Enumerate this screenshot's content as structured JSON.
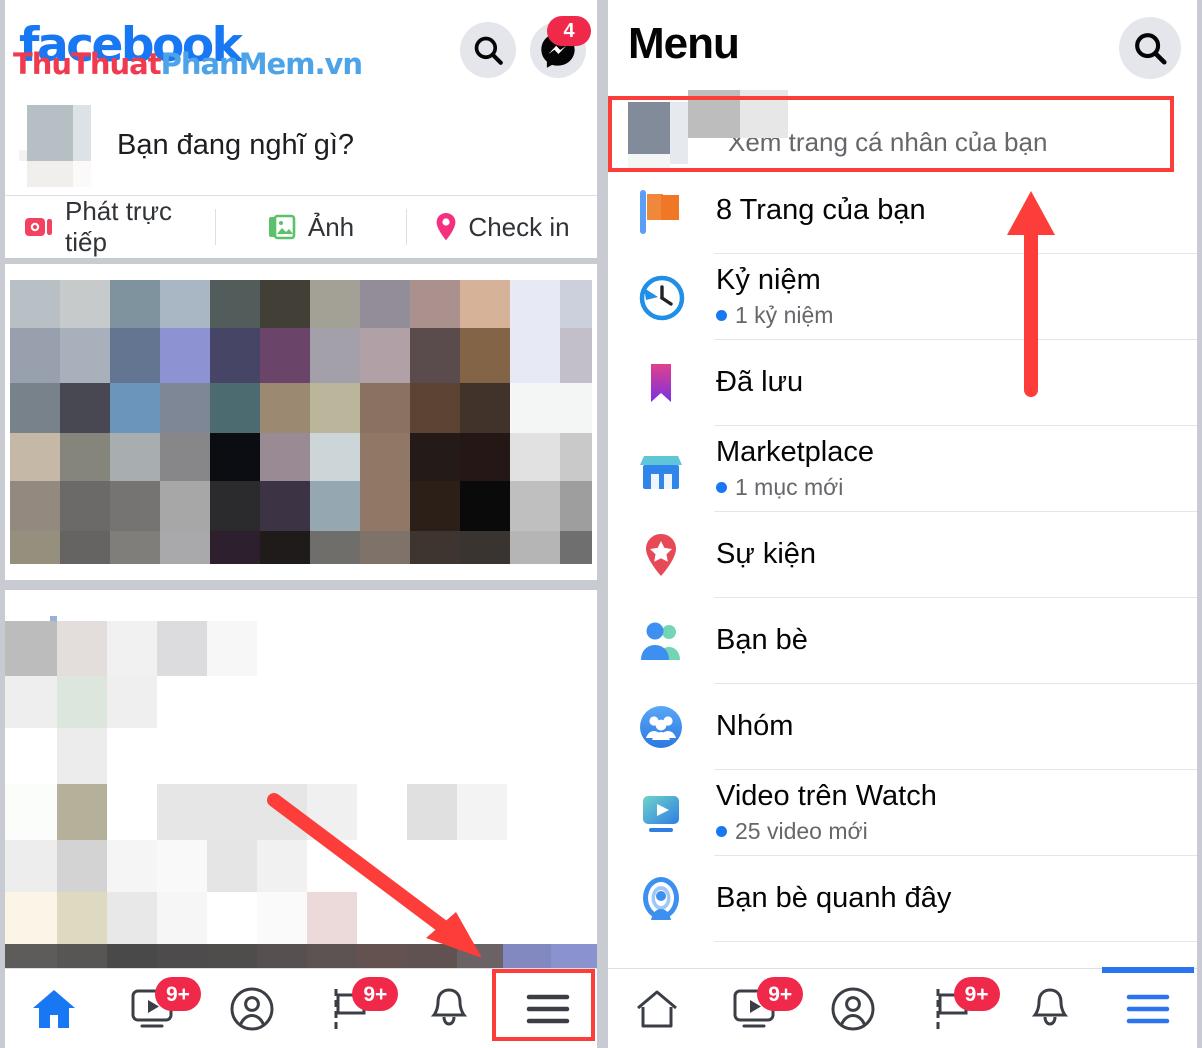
{
  "left_panel": {
    "brand": "facebook",
    "watermark": {
      "part1": "ThuThuat",
      "part2": "PhanMem.vn"
    },
    "header": {
      "search_icon": "search-icon",
      "messenger_icon": "messenger-icon",
      "messenger_badge": "4"
    },
    "composer": {
      "placeholder": "Bạn đang nghĩ gì?",
      "actions": [
        {
          "label": "Phát trực tiếp",
          "icon": "live-video-icon",
          "color": "#f3425f"
        },
        {
          "label": "Ảnh",
          "icon": "photo-icon",
          "color": "#45bd62"
        },
        {
          "label": "Check in",
          "icon": "location-pin-icon",
          "color": "#f5317f"
        }
      ]
    },
    "bottom_nav": [
      {
        "name": "home",
        "icon": "home-icon",
        "active": true,
        "badge": ""
      },
      {
        "name": "watch",
        "icon": "watch-video-icon",
        "active": false,
        "badge": "9+"
      },
      {
        "name": "profile",
        "icon": "profile-circle-icon",
        "active": false,
        "badge": ""
      },
      {
        "name": "pages",
        "icon": "pages-flag-icon",
        "active": false,
        "badge": "9+"
      },
      {
        "name": "notifications",
        "icon": "bell-icon",
        "active": false,
        "badge": ""
      },
      {
        "name": "menu",
        "icon": "hamburger-menu-icon",
        "active": false,
        "badge": ""
      }
    ]
  },
  "right_panel": {
    "title": "Menu",
    "search_icon": "search-icon",
    "profile": {
      "label": "Xem trang cá nhân của bạn"
    },
    "items": [
      {
        "label": "8 Trang của bạn",
        "sub": "",
        "icon": "pages-flag-icon"
      },
      {
        "label": "Kỷ niệm",
        "sub": "1 kỷ niệm",
        "icon": "memories-clock-icon"
      },
      {
        "label": "Đã lưu",
        "sub": "",
        "icon": "saved-bookmark-icon"
      },
      {
        "label": "Marketplace",
        "sub": "1 mục mới",
        "icon": "marketplace-storefront-icon"
      },
      {
        "label": "Sự kiện",
        "sub": "",
        "icon": "events-pin-icon"
      },
      {
        "label": "Bạn bè",
        "sub": "",
        "icon": "friends-icon"
      },
      {
        "label": "Nhóm",
        "sub": "",
        "icon": "groups-icon"
      },
      {
        "label": "Video trên Watch",
        "sub": "25 video mới",
        "icon": "watch-video-icon"
      },
      {
        "label": "Bạn bè quanh đây",
        "sub": "",
        "icon": "nearby-friends-icon"
      }
    ],
    "bottom_nav": [
      {
        "name": "home",
        "icon": "home-icon",
        "active": false,
        "badge": ""
      },
      {
        "name": "watch",
        "icon": "watch-video-icon",
        "active": false,
        "badge": "9+"
      },
      {
        "name": "profile",
        "icon": "profile-circle-icon",
        "active": false,
        "badge": ""
      },
      {
        "name": "pages",
        "icon": "pages-flag-icon",
        "active": false,
        "badge": "9+"
      },
      {
        "name": "notifications",
        "icon": "bell-icon",
        "active": false,
        "badge": ""
      },
      {
        "name": "menu",
        "icon": "hamburger-menu-icon",
        "active": true,
        "badge": ""
      }
    ]
  },
  "annotations": {
    "highlight_color": "#fc3d39",
    "boxes": [
      "menu-hamburger-tab-highlight",
      "view-profile-highlight"
    ],
    "arrows": [
      "arrow-to-hamburger-tab",
      "arrow-to-view-profile"
    ]
  },
  "colors": {
    "brand_blue": "#1877f2",
    "badge_red": "#f02849",
    "annotation_red": "#fc3d39",
    "text_primary": "#050505",
    "text_secondary": "#65676b"
  }
}
